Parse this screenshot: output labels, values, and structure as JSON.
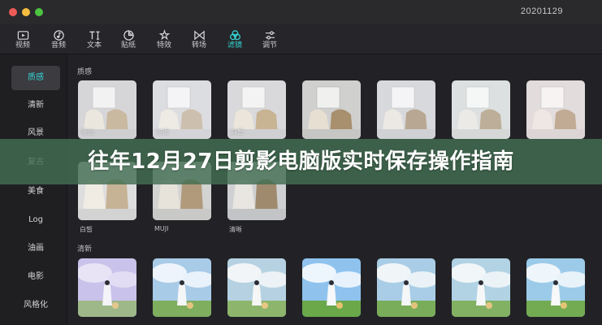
{
  "window": {
    "title": "20201129"
  },
  "toolbar": {
    "items": [
      {
        "label": "视频",
        "icon": "video-icon"
      },
      {
        "label": "音频",
        "icon": "music-icon"
      },
      {
        "label": "文本",
        "icon": "text-icon"
      },
      {
        "label": "贴纸",
        "icon": "sticker-icon"
      },
      {
        "label": "特效",
        "icon": "effects-icon"
      },
      {
        "label": "转场",
        "icon": "transition-icon"
      },
      {
        "label": "滤镜",
        "icon": "filter-icon"
      },
      {
        "label": "调节",
        "icon": "adjust-icon"
      }
    ],
    "active": "滤镜"
  },
  "sidebar": {
    "items": [
      {
        "label": "质感"
      },
      {
        "label": "清新"
      },
      {
        "label": "风景"
      },
      {
        "label": "复古"
      },
      {
        "label": "美食"
      },
      {
        "label": "Log"
      },
      {
        "label": "油画"
      },
      {
        "label": "电影"
      },
      {
        "label": "风格化"
      }
    ],
    "active": "质感"
  },
  "sections": {
    "texture": {
      "title": "质感",
      "row1": [
        {
          "label": "哑光"
        },
        {
          "label": "灰调"
        },
        {
          "label": "白皙"
        },
        {
          "label": ""
        },
        {
          "label": ""
        },
        {
          "label": ""
        },
        {
          "label": ""
        }
      ],
      "row2": [
        {
          "label": "白皙"
        },
        {
          "label": "MUJI"
        },
        {
          "label": "清晰"
        }
      ]
    },
    "fresh": {
      "title": "清新"
    }
  },
  "banner": {
    "text": "往年12月27日剪影电脑版实时保存操作指南"
  },
  "colors": {
    "accent": "#33d6d4",
    "banner_bg": "#426e52"
  }
}
